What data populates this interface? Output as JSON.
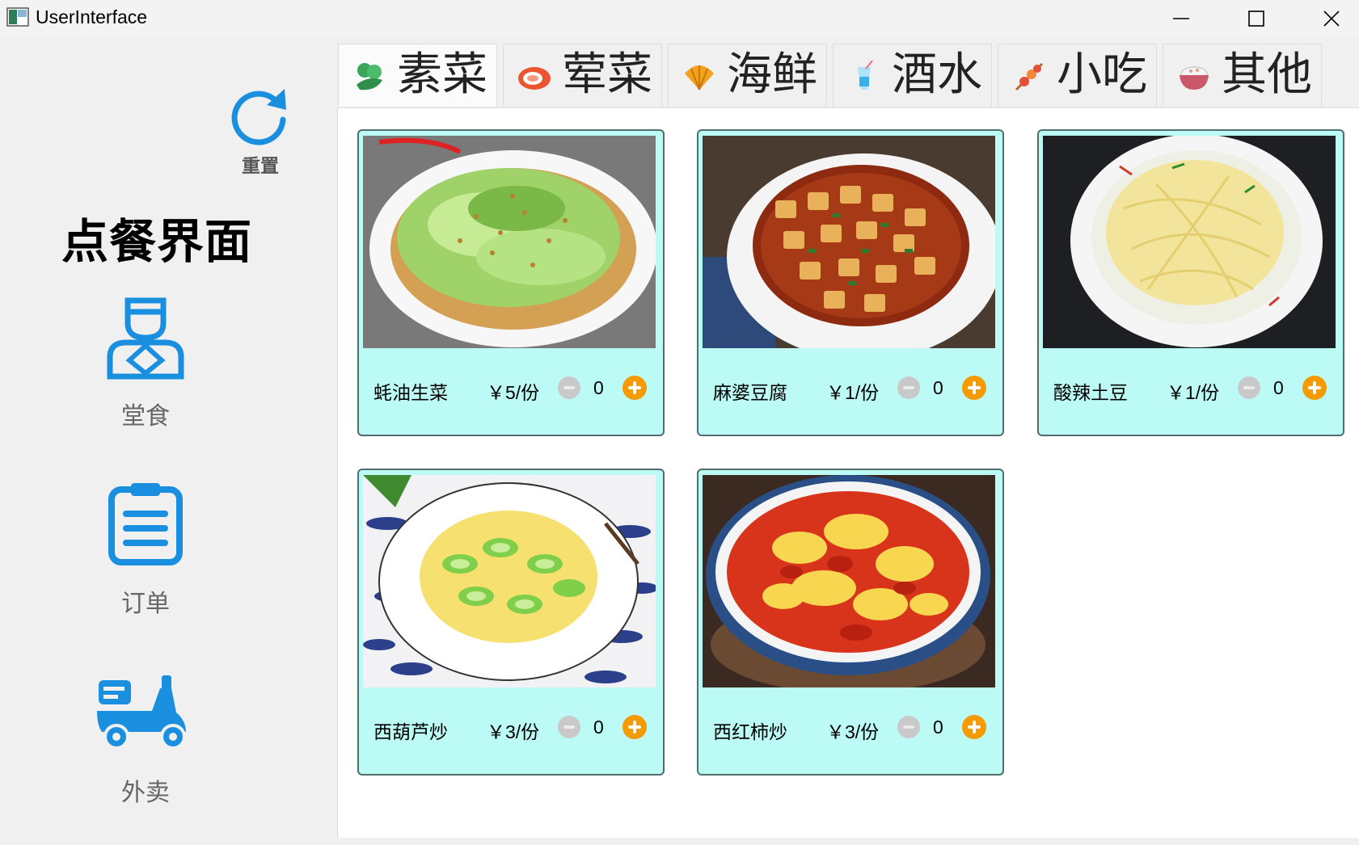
{
  "window": {
    "title": "UserInterface"
  },
  "sidebar": {
    "reset_label": "重置",
    "page_title": "点餐界面",
    "nav": [
      {
        "label": "堂食",
        "icon": "waiter-icon"
      },
      {
        "label": "订单",
        "icon": "clipboard-icon"
      },
      {
        "label": "外卖",
        "icon": "scooter-icon"
      }
    ],
    "accent_color": "#1a8fe0"
  },
  "tabs": [
    {
      "label": "素菜",
      "icon": "vegetable-icon",
      "active": true
    },
    {
      "label": "荤菜",
      "icon": "meat-icon",
      "active": false
    },
    {
      "label": "海鲜",
      "icon": "shell-icon",
      "active": false
    },
    {
      "label": "酒水",
      "icon": "drink-icon",
      "active": false
    },
    {
      "label": "小吃",
      "icon": "skewer-icon",
      "active": false
    },
    {
      "label": "其他",
      "icon": "rice-bowl-icon",
      "active": false
    }
  ],
  "dishes": [
    {
      "name": "蚝油生菜",
      "price": "￥5/份",
      "qty": "0",
      "image": "lettuce-dish"
    },
    {
      "name": "麻婆豆腐",
      "price": "￥1/份",
      "qty": "0",
      "image": "mapo-tofu-dish"
    },
    {
      "name": "酸辣土豆",
      "price": "￥1/份",
      "qty": "0",
      "image": "potato-shreds-dish"
    },
    {
      "name": "西葫芦炒",
      "price": "￥3/份",
      "qty": "0",
      "image": "zucchini-egg-dish"
    },
    {
      "name": "西红柿炒",
      "price": "￥3/份",
      "qty": "0",
      "image": "tomato-egg-dish"
    }
  ],
  "colors": {
    "card_bg": "#bcfaf6",
    "plus": "#f59a00",
    "minus": "#c9c9c9"
  }
}
